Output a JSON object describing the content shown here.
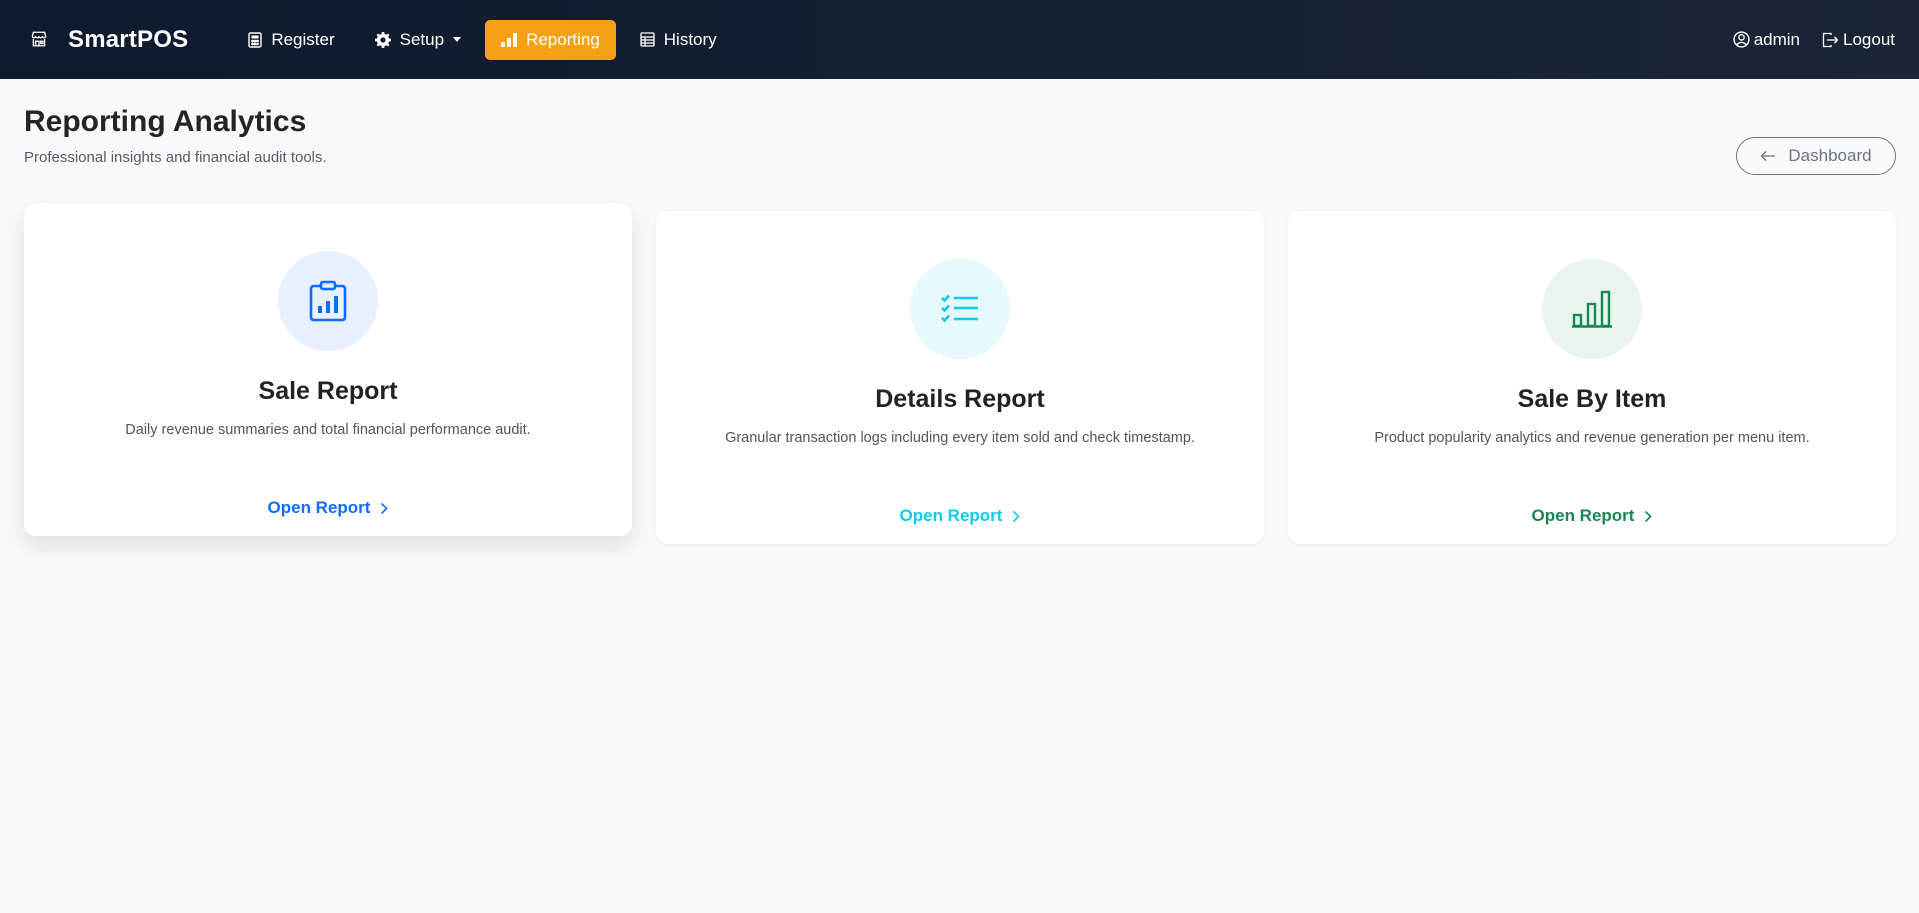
{
  "app": {
    "brand": "SmartPOS"
  },
  "nav": {
    "items": [
      {
        "label": "Register"
      },
      {
        "label": "Setup"
      },
      {
        "label": "Reporting"
      },
      {
        "label": "History"
      }
    ],
    "active": "Reporting",
    "user": "admin",
    "logout": "Logout"
  },
  "page": {
    "title": "Reporting Analytics",
    "subtitle": "Professional insights and financial audit tools.",
    "back_label": "Dashboard"
  },
  "cards": [
    {
      "title": "Sale Report",
      "description": "Daily revenue summaries and total financial performance audit.",
      "link": "Open Report",
      "accent": "#0d6efd",
      "icon_bg": "#e6f0ff",
      "icon": "clipboard-chart-icon"
    },
    {
      "title": "Details Report",
      "description": "Granular transaction logs including every item sold and check timestamp.",
      "link": "Open Report",
      "accent": "#0dcaf0",
      "icon_bg": "#e6f9fd",
      "icon": "list-check-icon"
    },
    {
      "title": "Sale By Item",
      "description": "Product popularity analytics and revenue generation per menu item.",
      "link": "Open Report",
      "accent": "#198754",
      "icon_bg": "#e9f4ef",
      "icon": "bar-chart-icon"
    }
  ],
  "colors": {
    "nav_bg": "#111c30",
    "active_nav": "#f7a014",
    "page_bg": "#f8f9fb"
  }
}
